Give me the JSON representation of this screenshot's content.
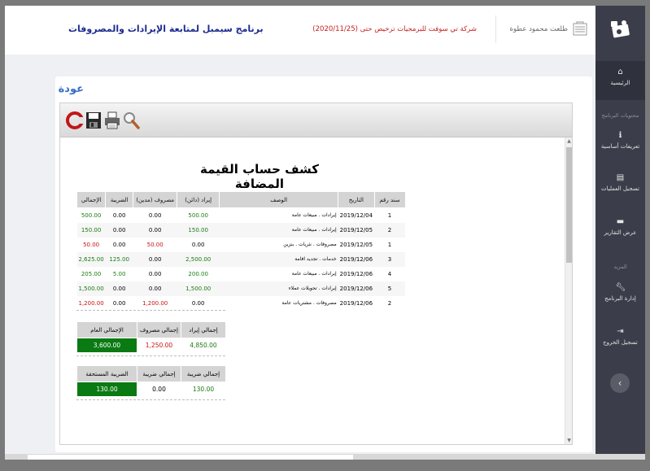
{
  "header": {
    "app_title": "برنامج سيمبل لمتابعة الإيرادات والمصروفات",
    "license": "شركة تي سوفت للبرمجيات ترخيص حتى (2020/11/25)",
    "user_name": "طلعت محمود عطوة"
  },
  "sidebar": {
    "items": [
      {
        "label": "الرئيسية",
        "icon": "home-icon"
      },
      {
        "label": "تعريفات أساسية",
        "icon": "info-icon"
      },
      {
        "label": "تسجيل العمليات",
        "icon": "list-icon"
      },
      {
        "label": "عرض التقارير",
        "icon": "report-icon"
      },
      {
        "label": "إدارة البرنامج",
        "icon": "wrench-icon"
      },
      {
        "label": "تسجيل الخروج",
        "icon": "logout-icon"
      }
    ],
    "sections": [
      "محتويات البرنامج",
      "المزيد"
    ],
    "toggle_icon": "chevron-left-icon"
  },
  "page": {
    "back_label": "عودة"
  },
  "toolbar": {
    "buttons": [
      "refresh-icon",
      "save-icon",
      "print-icon",
      "zoom-icon"
    ]
  },
  "report": {
    "title": "كشف حساب القيمة المضافة",
    "columns": [
      "سند رقم",
      "التاريخ",
      "الوصف",
      "إيراد (دائن)",
      "مصروف (مدين)",
      "الضريبة",
      "الإجمالي"
    ],
    "rows": [
      {
        "no": "1",
        "date": "2019/12/04",
        "desc": "إيرادات . مبيعات عامة",
        "income": "500.00",
        "expense": "0.00",
        "tax": "0.00",
        "total": "500.00",
        "type": "income"
      },
      {
        "no": "2",
        "date": "2019/12/05",
        "desc": "إيرادات . مبيعات عامة",
        "income": "150.00",
        "expense": "0.00",
        "tax": "0.00",
        "total": "150.00",
        "type": "income"
      },
      {
        "no": "1",
        "date": "2019/12/05",
        "desc": "مصروفات . نثريات . بنزين",
        "income": "0.00",
        "expense": "50.00",
        "tax": "0.00",
        "total": "50.00",
        "type": "expense"
      },
      {
        "no": "3",
        "date": "2019/12/06",
        "desc": "خدمات . تجديد اقامة",
        "income": "2,500.00",
        "expense": "0.00",
        "tax": "125.00",
        "total": "2,625.00",
        "type": "income"
      },
      {
        "no": "4",
        "date": "2019/12/06",
        "desc": "إيرادات . مبيعات عامة",
        "income": "200.00",
        "expense": "0.00",
        "tax": "5.00",
        "total": "205.00",
        "type": "income"
      },
      {
        "no": "5",
        "date": "2019/12/06",
        "desc": "إيرادات . تحويلات عملاء",
        "income": "1,500.00",
        "expense": "0.00",
        "tax": "0.00",
        "total": "1,500.00",
        "type": "income"
      },
      {
        "no": "2",
        "date": "2019/12/06",
        "desc": "مصروفات . مشتريات عامة",
        "income": "0.00",
        "expense": "1,200.00",
        "tax": "0.00",
        "total": "1,200.00",
        "type": "expense"
      }
    ],
    "summary1": {
      "headers": [
        "إجمالي إيراد",
        "إجمالي مصروف",
        "الإجمالي العام"
      ],
      "values": [
        "4,850.00",
        "1,250.00",
        "3,600.00"
      ]
    },
    "summary2": {
      "headers": [
        "إجمالي ضريبة",
        "إجمالي ضريبة",
        "الضريبة المستحقة"
      ],
      "values": [
        "130.00",
        "0.00",
        "130.00"
      ]
    }
  },
  "colors": {
    "income": "#1b7a12",
    "expense": "#cc1111",
    "sidebar_bg": "#3b3e4a",
    "title_blue": "#1c2b8f"
  }
}
